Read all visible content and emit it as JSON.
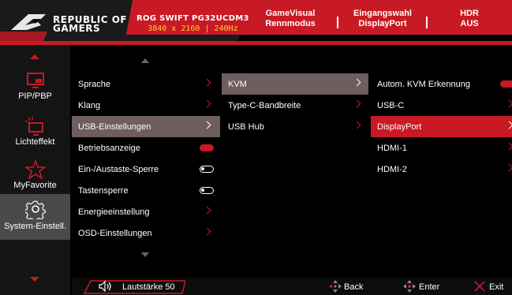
{
  "header": {
    "brand_line1": "REPUBLIC OF",
    "brand_line2": "GAMERS",
    "model": "ROG SWIFT PG32UCDM3",
    "spec": "3840 x 2160  |  240Hz",
    "status": [
      {
        "title": "GameVisual",
        "value": "Rennmodus"
      },
      {
        "title": "Eingangswahl",
        "value": "DisplayPort"
      },
      {
        "title": "HDR",
        "value": "AUS"
      }
    ]
  },
  "sidebar": {
    "items": [
      {
        "label": "PIP/PBP",
        "icon": "pip-icon"
      },
      {
        "label": "Lichteffekt",
        "icon": "light-effect-icon"
      },
      {
        "label": "MyFavorite",
        "icon": "star-icon"
      },
      {
        "label": "System-Einstell.",
        "icon": "gear-icon"
      }
    ],
    "active_index": 3
  },
  "menu": {
    "items": [
      {
        "label": "Sprache",
        "control": "arrow"
      },
      {
        "label": "Klang",
        "control": "arrow"
      },
      {
        "label": "USB-Einstellungen",
        "control": "arrow",
        "state": "selected"
      },
      {
        "label": "Betriebsanzeige",
        "control": "toggle-on"
      },
      {
        "label": "Ein-/Austaste-Sperre",
        "control": "toggle-off"
      },
      {
        "label": "Tastensperre",
        "control": "toggle-off"
      },
      {
        "label": "Energieeinstellung",
        "control": "arrow"
      },
      {
        "label": "OSD-Einstellungen",
        "control": "arrow"
      }
    ]
  },
  "submenu": {
    "items": [
      {
        "label": "KVM",
        "state": "selected"
      },
      {
        "label": "Type-C-Bandbreite"
      },
      {
        "label": "USB Hub"
      }
    ]
  },
  "options": {
    "items": [
      {
        "label": "Autom. KVM Erkennung",
        "control": "toggle-on"
      },
      {
        "label": "USB-C",
        "control": "arrow"
      },
      {
        "label": "DisplayPort",
        "control": "arrow",
        "state": "highlighted"
      },
      {
        "label": "HDMI-1",
        "control": "arrow"
      },
      {
        "label": "HDMI-2",
        "control": "arrow"
      }
    ]
  },
  "footer": {
    "volume_label": "Lautstärke  50",
    "back_label": "Back",
    "enter_label": "Enter",
    "exit_label": "Exit"
  },
  "colors": {
    "accent": "#c81a24",
    "selected_bg": "#6f5e5e",
    "sidebar_active": "#4a4a4a"
  }
}
